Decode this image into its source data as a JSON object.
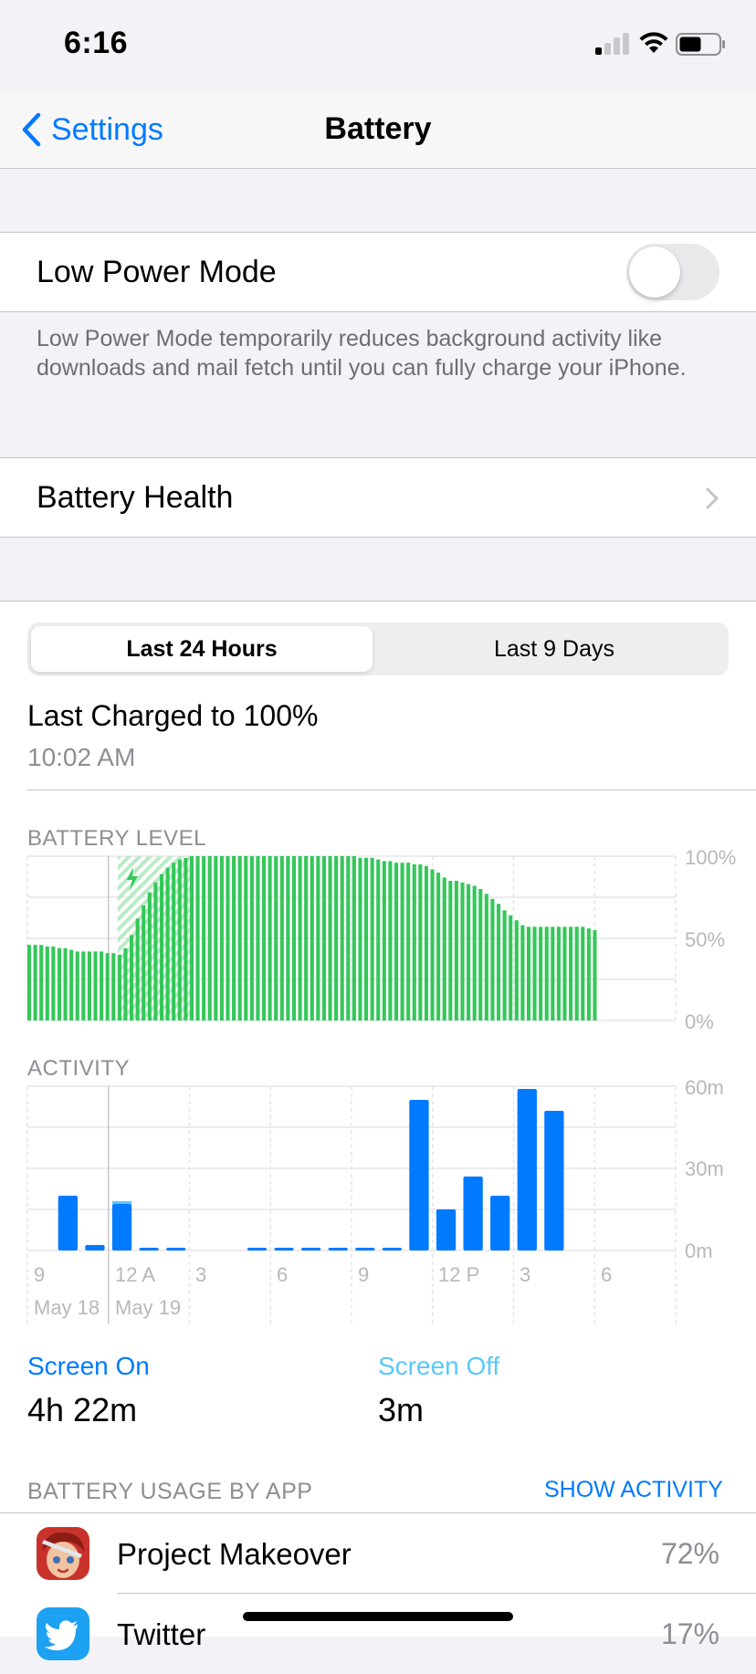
{
  "status": {
    "time": "6:16"
  },
  "nav": {
    "back_label": "Settings",
    "title": "Battery"
  },
  "low_power": {
    "label": "Low Power Mode",
    "enabled": false,
    "footer": "Low Power Mode temporarily reduces background activity like downloads and mail fetch until you can fully charge your iPhone."
  },
  "battery_health": {
    "label": "Battery Health"
  },
  "segments": {
    "active": "Last 24 Hours",
    "inactive": "Last 9 Days"
  },
  "last_charged": {
    "title": "Last Charged to 100%",
    "time": "10:02 AM"
  },
  "battery_chart_label": "BATTERY LEVEL",
  "activity_chart_label": "ACTIVITY",
  "x_ticks": [
    "9",
    "12 A",
    "3",
    "6",
    "9",
    "12 P",
    "3",
    "6"
  ],
  "x_dates": [
    "May 18",
    "May 19"
  ],
  "battery_y_ticks": [
    "100%",
    "50%",
    "0%"
  ],
  "activity_y_ticks": [
    "60m",
    "30m",
    "0m"
  ],
  "chart_data": [
    {
      "type": "bar",
      "name": "battery-level",
      "ylabel": "",
      "ylim": [
        0,
        100
      ],
      "x_ticks": [
        "9",
        "12 A",
        "3",
        "6",
        "9",
        "12 P",
        "3",
        "6"
      ],
      "y_ticks": [
        "100%",
        "50%",
        "0%"
      ],
      "values": [
        46,
        46,
        46,
        45,
        45,
        44,
        44,
        43,
        42,
        42,
        42,
        42,
        42,
        41,
        41,
        40,
        44,
        52,
        62,
        70,
        78,
        84,
        89,
        93,
        96,
        98,
        99,
        100,
        100,
        100,
        100,
        100,
        100,
        100,
        100,
        100,
        100,
        100,
        100,
        100,
        100,
        100,
        100,
        100,
        100,
        100,
        100,
        100,
        100,
        100,
        100,
        100,
        100,
        100,
        100,
        99,
        99,
        99,
        98,
        97,
        97,
        96,
        96,
        96,
        95,
        95,
        94,
        92,
        90,
        87,
        85,
        85,
        84,
        83,
        82,
        80,
        77,
        74,
        71,
        67,
        64,
        61,
        58,
        57,
        57,
        57,
        57,
        57,
        57,
        57,
        57,
        57,
        57,
        56,
        55
      ],
      "charging_range": [
        15,
        27
      ],
      "color": "#34c759"
    },
    {
      "type": "bar",
      "name": "activity",
      "ylabel": "",
      "ylim": [
        0,
        60
      ],
      "x_ticks": [
        "9",
        "12 A",
        "3",
        "6",
        "9",
        "12 P",
        "3",
        "6"
      ],
      "y_ticks": [
        "60m",
        "30m",
        "0m"
      ],
      "categories": [
        0,
        1,
        2,
        3,
        4,
        5,
        6,
        7,
        8,
        9,
        10,
        11,
        12,
        13,
        14,
        15,
        16,
        17,
        18,
        19,
        20,
        21,
        22,
        23
      ],
      "values": [
        0,
        20,
        2,
        17,
        1,
        1,
        0,
        0,
        1,
        1,
        1,
        1,
        1,
        1,
        55,
        15,
        27,
        20,
        59,
        51,
        0,
        0,
        0,
        0
      ],
      "screen_off_values": [
        0,
        0,
        0,
        1,
        0,
        0,
        0,
        0,
        0,
        0,
        0,
        0,
        0,
        0,
        0,
        0,
        0,
        0,
        0,
        0,
        0,
        0,
        0,
        0
      ],
      "color": "#007aff"
    }
  ],
  "screen_usage": {
    "on_label": "Screen On",
    "on_value": "4h 22m",
    "off_label": "Screen Off",
    "off_value": "3m"
  },
  "usage_section": {
    "title": "BATTERY USAGE BY APP",
    "action": "SHOW ACTIVITY"
  },
  "apps": [
    {
      "name": "Project Makeover",
      "percent": "72%"
    },
    {
      "name": "Twitter",
      "percent": "17%"
    }
  ],
  "colors": {
    "accent": "#007aff",
    "battery": "#34c759",
    "screen_off": "#5ac8fa",
    "secondary_text": "#8e8e93"
  }
}
